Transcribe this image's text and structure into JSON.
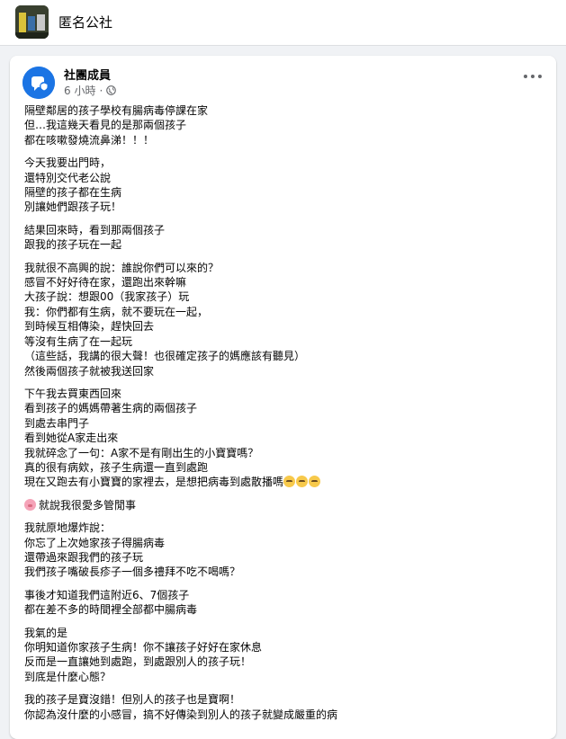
{
  "header": {
    "group_name": "匿名公社"
  },
  "post": {
    "author": "社團成員",
    "time": "6 小時",
    "separator": "·",
    "paragraphs": [
      [
        "隔壁鄰居的孩子學校有腸病毒停課在家",
        "但…我這幾天看見的是那兩個孩子",
        "都在咳嗽發燒流鼻涕！！！"
      ],
      [
        "今天我要出門時，",
        "還特別交代老公說",
        "隔壁的孩子都在生病",
        "別讓她們跟孩子玩！"
      ],
      [
        "結果回來時，看到那兩個孩子",
        "跟我的孩子玩在一起"
      ],
      [
        "我就很不高興的說：誰說你們可以來的？",
        "感冒不好好待在家，還跑出來幹嘛",
        "大孩子說：想跟00（我家孩子）玩",
        "我：你們都有生病，就不要玩在一起，",
        "到時候互相傳染，趕快回去",
        "等沒有生病了在一起玩",
        "（這些話，我講的很大聲！也很確定孩子的媽應該有聽見）",
        "然後兩個孩子就被我送回家"
      ],
      [
        "下午我去買東西回來",
        "看到孩子的媽媽帶著生病的兩個孩子",
        "到處去串門子",
        "看到她從A家走出來",
        "我就碎念了一句：A家不是有剛出生的小寶寶嗎？",
        "真的很有病欸，孩子生病還一直到處跑",
        "現在又跑去有小寶寶的家裡去，是想把病毒到處散播嗎"
      ],
      [
        "就說我很愛多管閒事"
      ],
      [
        "我就原地爆炸說：",
        "你忘了上次她家孩子得腸病毒",
        "還帶過來跟我們的孩子玩",
        "我們孩子嘴破長疹子一個多禮拜不吃不喝嗎？"
      ],
      [
        "事後才知道我們這附近6、7個孩子",
        "都在差不多的時間裡全部都中腸病毒"
      ],
      [
        "我氣的是",
        "你明知道你家孩子生病！你不讓孩子好好在家休息",
        "反而是一直讓她到處跑，到處跟別人的孩子玩！",
        "到底是什麼心態？"
      ],
      [
        "我的孩子是寶沒錯！但別人的孩子也是寶啊！",
        "你認為沒什麼的小感冒，搞不好傳染到別人的孩子就變成嚴重的病"
      ]
    ],
    "icons": {
      "more": "more-horizontal-icon",
      "privacy": "globe-icon",
      "avatar": "anonymous-member-avatar",
      "emoji_rolling_eyes": "rolling-eyes-emoji",
      "emoji_pig": "pig-emoji"
    }
  }
}
